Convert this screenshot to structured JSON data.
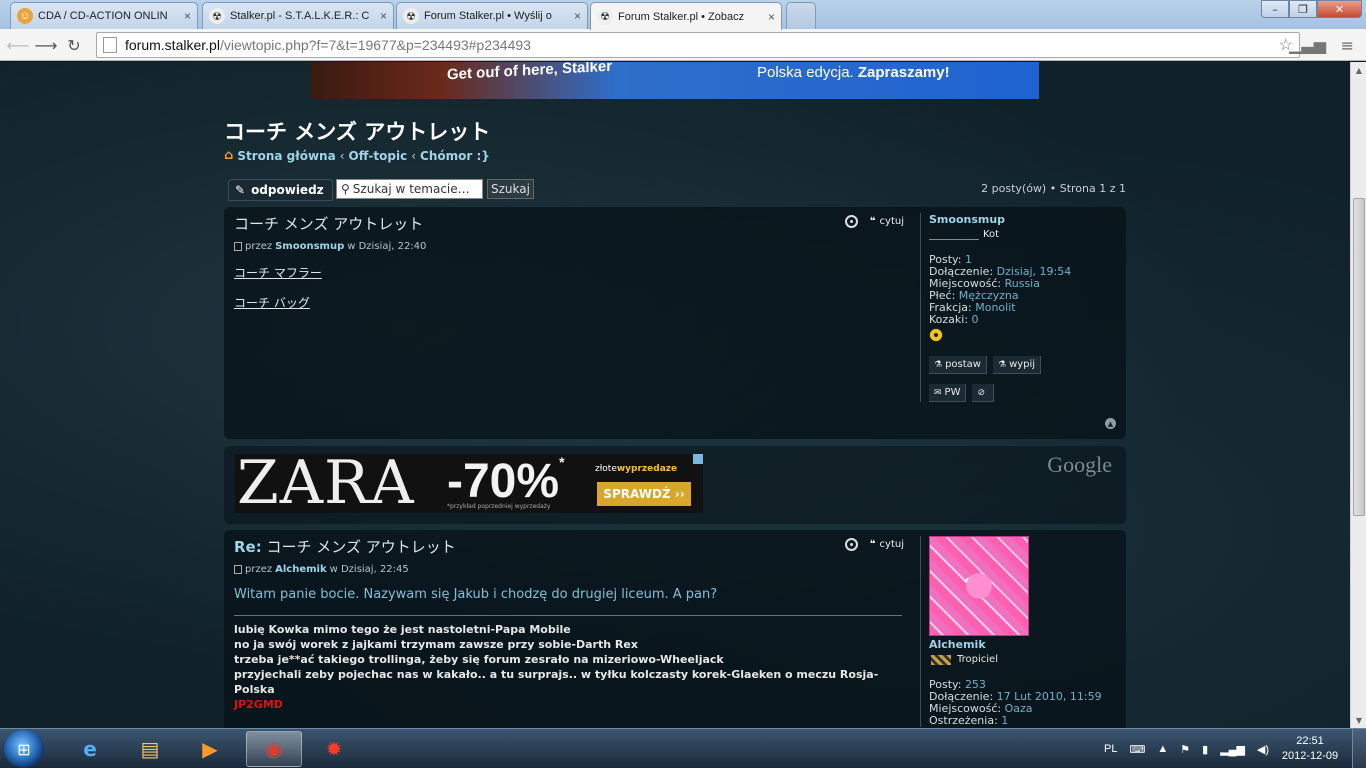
{
  "browser": {
    "tabs": [
      {
        "title": "CDA / CD-ACTION ONLIN",
        "close": "×",
        "fav": "☺",
        "fav_color": "#e8a33a"
      },
      {
        "title": "Stalker.pl - S.T.A.L.K.E.R.: C",
        "close": "×",
        "fav": "☢",
        "fav_color": "#333333"
      },
      {
        "title": "Forum Stalker.pl • Wyślij o",
        "close": "×",
        "fav": "☢",
        "fav_color": "#333333"
      },
      {
        "title": "Forum Stalker.pl • Zobacz",
        "close": "×",
        "fav": "☢",
        "fav_color": "#333333"
      }
    ],
    "url_host": "forum.stalker.pl",
    "url_path": "/viewtopic.php?f=7&t=19677&p=234493#p234493",
    "window_buttons": {
      "minimize": "–",
      "maximize": "❐",
      "close": "✕"
    }
  },
  "banner": {
    "left_text": "Get ouf of here, Stalker",
    "right_text": "Polska edycja.",
    "right_bold": "Zapraszamy!"
  },
  "topic": {
    "title": "コーチ メンズ アウトレット",
    "breadcrumbs": [
      "Strona główna",
      "Off-topic",
      "Chómor :}"
    ],
    "crumb_sep": "‹"
  },
  "actions": {
    "reply_label": "odpowiedz",
    "search_placeholder": "Szukaj w temacie…",
    "search_button": "Szukaj",
    "pagination": "2 posty(ów) • Strona 1 z 1"
  },
  "posts": [
    {
      "title": "コーチ メンズ アウトレット",
      "meta_by": "przez",
      "author": "Smoonsmup",
      "meta_when": "w Dzisiaj, 22:40",
      "links": [
        "コーチ マフラー",
        "コーチ バッグ"
      ],
      "quote_label": "cytuj",
      "profile": {
        "username": "Smoonsmup",
        "rank": "Kot",
        "fields": [
          {
            "label": "Posty:",
            "value": "1"
          },
          {
            "label": "Dołączenie:",
            "value": "Dzisiaj, 19:54"
          },
          {
            "label": "Miejscowość:",
            "value": "Russia"
          },
          {
            "label": "Płeć:",
            "value": "Mężczyzna"
          },
          {
            "label": "Frakcja:",
            "value": "Monolit"
          },
          {
            "label": "Kozaki:",
            "value": "0"
          }
        ],
        "buttons": [
          "postaw",
          "wypij",
          "PW"
        ]
      }
    },
    {
      "title_prefix": "Re:",
      "title": "コーチ メンズ アウトレット",
      "meta_by": "przez",
      "author": "Alchemik",
      "meta_when": "w Dzisiaj, 22:45",
      "message": "Witam panie bocie. Nazywam się Jakub i chodzę do drugiej liceum. A pan?",
      "signature": [
        "lubię Kowka mimo tego że jest nastoletni-Papa Mobile",
        "no ja swój worek z jajkami trzymam zawsze przy sobie-Darth Rex",
        "trzeba je**ać takiego trollinga, żeby się forum zesrało na mizeriowo-Wheeljack",
        "przyjechali zeby pojechac nas w kakało.. a tu surprajs.. w tyłku kolczasty korek-Glaeken o meczu Rosja-Polska"
      ],
      "signature_red": "JP2GMD",
      "quote_label": "cytuj",
      "profile": {
        "username": "Alchemik",
        "rank": "Tropiciel",
        "fields": [
          {
            "label": "Posty:",
            "value": "253"
          },
          {
            "label": "Dołączenie:",
            "value": "17 Lut 2010, 11:59"
          },
          {
            "label": "Miejscowość:",
            "value": "Oaza"
          },
          {
            "label": "Ostrzeżenia:",
            "value": "1"
          }
        ]
      }
    }
  ],
  "ad": {
    "brand": "ZARA",
    "discount": "-70%",
    "star": "*",
    "small_print": "*przykład poprzedniej wyprzedaży",
    "partner_prefix": "złote",
    "partner_bold": "wyprzedaze",
    "cta": "SPRAWDŹ ››",
    "network": "Google"
  },
  "taskbar": {
    "lang": "PL",
    "time": "22:51",
    "date": "2012-12-09"
  },
  "colors": {
    "link": "#9fd3e8",
    "accent_orange": "#f39c3d",
    "signature_red": "#e01010"
  }
}
